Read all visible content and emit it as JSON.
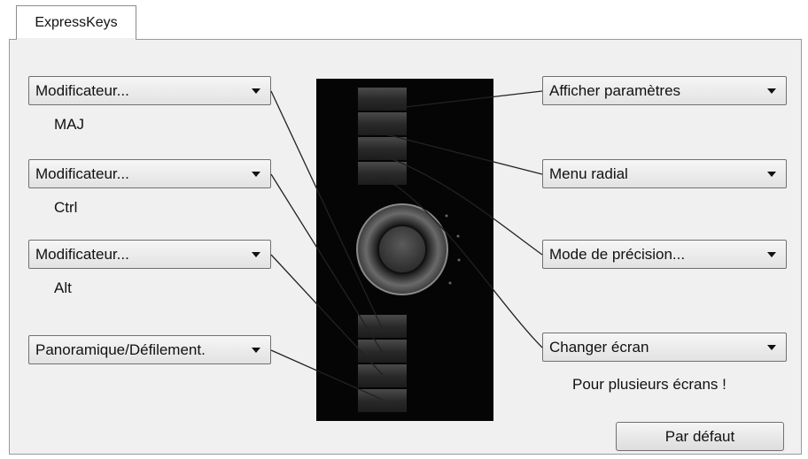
{
  "tab": {
    "label": "ExpressKeys"
  },
  "left_keys": [
    {
      "label": "Modificateur...",
      "sub": "MAJ"
    },
    {
      "label": "Modificateur...",
      "sub": "Ctrl"
    },
    {
      "label": "Modificateur...",
      "sub": "Alt"
    },
    {
      "label": "Panoramique/Défilement.",
      "sub": ""
    }
  ],
  "right_keys": [
    {
      "label": "Afficher paramètres",
      "sub": ""
    },
    {
      "label": "Menu radial",
      "sub": ""
    },
    {
      "label": "Mode de précision...",
      "sub": ""
    },
    {
      "label": "Changer écran",
      "sub": "Pour plusieurs écrans !"
    }
  ],
  "default_button": {
    "label": "Par défaut"
  },
  "icons": {
    "dropdown": "chevron-down-icon",
    "device": "tablet-expresskeys-illustration"
  }
}
